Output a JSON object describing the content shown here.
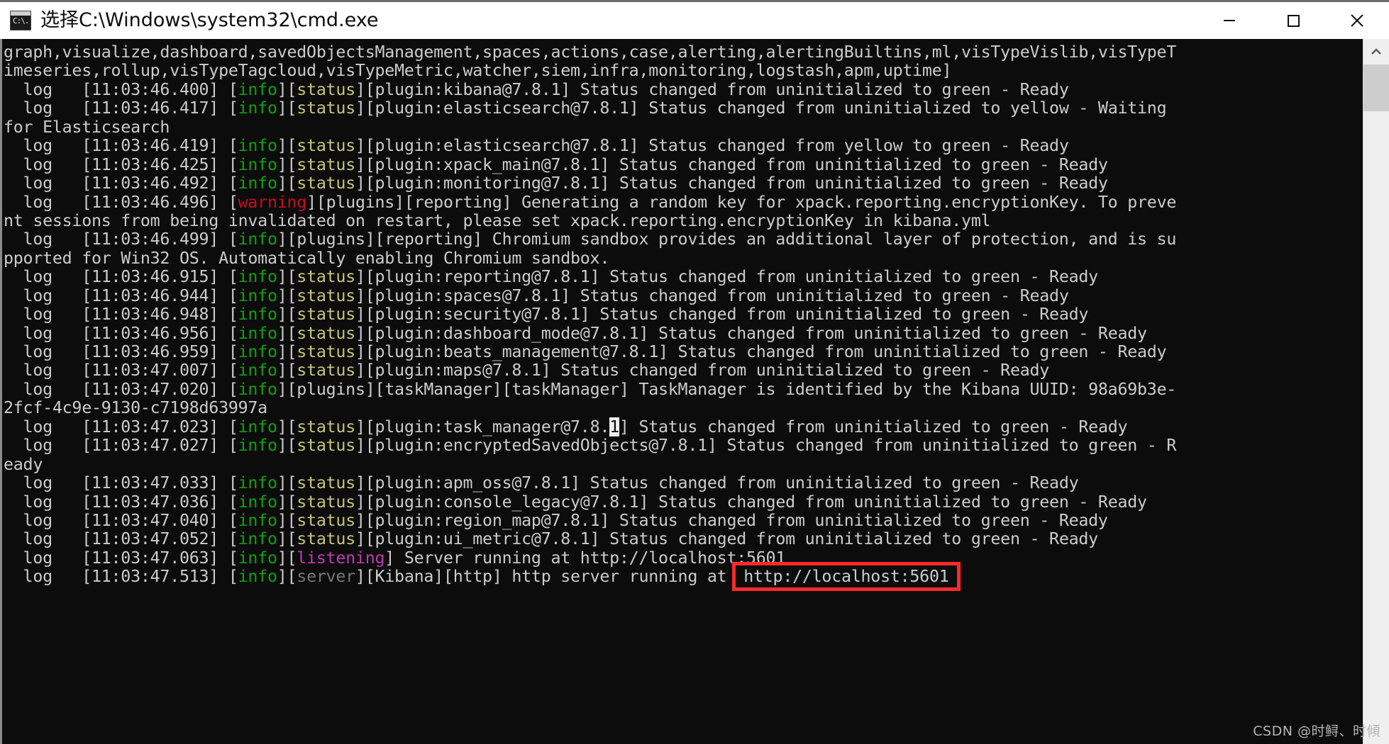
{
  "window": {
    "title": "选择C:\\Windows\\system32\\cmd.exe",
    "icon_name": "cmd-icon",
    "icon_prompt": "C:\\.",
    "minimize_label": "—",
    "maximize_label": "□",
    "close_label": "✕"
  },
  "watermark": "CSDN @时鲟、时傾",
  "colors": {
    "console_bg": "#0c0c0c",
    "console_fg": "#cccccc",
    "info": "#13a10e",
    "status": "#c5c57a",
    "warning": "#c50f1f",
    "listening": "#c239b3",
    "server": "#767676",
    "highlight_box": "#fa2a2a",
    "selection_bg": "#eeeeee"
  },
  "scrollbar": {
    "up_arrow": "▲",
    "thumb_position": "near-top"
  },
  "console": {
    "lines": [
      {
        "id": "l1",
        "parts": [
          {
            "t": "graph,visualize,dashboard,savedObjectsManagement,spaces,actions,case,alerting,alertingBuiltins,ml,visTypeVislib,visTypeT",
            "c": "c-default"
          }
        ]
      },
      {
        "id": "l2",
        "parts": [
          {
            "t": "imeseries,rollup,visTypeTagcloud,visTypeMetric,watcher,siem,infra,monitoring,logstash,apm,uptime]",
            "c": "c-default"
          }
        ]
      },
      {
        "id": "l3",
        "parts": [
          {
            "t": "  log   [11:03:46.400] [",
            "c": "c-default"
          },
          {
            "t": "info",
            "c": "c-green"
          },
          {
            "t": "][",
            "c": "c-default"
          },
          {
            "t": "status",
            "c": "c-yellow"
          },
          {
            "t": "][plugin:kibana@7.8.1] Status changed from uninitialized to green - Ready",
            "c": "c-default"
          }
        ]
      },
      {
        "id": "l4",
        "parts": [
          {
            "t": "  log   [11:03:46.417] [",
            "c": "c-default"
          },
          {
            "t": "info",
            "c": "c-green"
          },
          {
            "t": "][",
            "c": "c-default"
          },
          {
            "t": "status",
            "c": "c-yellow"
          },
          {
            "t": "][plugin:elasticsearch@7.8.1] Status changed from uninitialized to yellow - Waiting",
            "c": "c-default"
          }
        ]
      },
      {
        "id": "l5",
        "parts": [
          {
            "t": "for Elasticsearch",
            "c": "c-default"
          }
        ]
      },
      {
        "id": "l6",
        "parts": [
          {
            "t": "  log   [11:03:46.419] [",
            "c": "c-default"
          },
          {
            "t": "info",
            "c": "c-green"
          },
          {
            "t": "][",
            "c": "c-default"
          },
          {
            "t": "status",
            "c": "c-yellow"
          },
          {
            "t": "][plugin:elasticsearch@7.8.1] Status changed from yellow to green - Ready",
            "c": "c-default"
          }
        ]
      },
      {
        "id": "l7",
        "parts": [
          {
            "t": "  log   [11:03:46.425] [",
            "c": "c-default"
          },
          {
            "t": "info",
            "c": "c-green"
          },
          {
            "t": "][",
            "c": "c-default"
          },
          {
            "t": "status",
            "c": "c-yellow"
          },
          {
            "t": "][plugin:xpack_main@7.8.1] Status changed from uninitialized to green - Ready",
            "c": "c-default"
          }
        ]
      },
      {
        "id": "l8",
        "parts": [
          {
            "t": "  log   [11:03:46.492] [",
            "c": "c-default"
          },
          {
            "t": "info",
            "c": "c-green"
          },
          {
            "t": "][",
            "c": "c-default"
          },
          {
            "t": "status",
            "c": "c-yellow"
          },
          {
            "t": "][plugin:monitoring@7.8.1] Status changed from uninitialized to green - Ready",
            "c": "c-default"
          }
        ]
      },
      {
        "id": "l9",
        "parts": [
          {
            "t": "  log   [11:03:46.496] [",
            "c": "c-default"
          },
          {
            "t": "warning",
            "c": "c-red"
          },
          {
            "t": "][plugins][reporting] Generating a random key for xpack.reporting.encryptionKey. To preve",
            "c": "c-default"
          }
        ]
      },
      {
        "id": "l10",
        "parts": [
          {
            "t": "nt sessions from being invalidated on restart, please set xpack.reporting.encryptionKey in kibana.yml",
            "c": "c-default"
          }
        ]
      },
      {
        "id": "l11",
        "parts": [
          {
            "t": "  log   [11:03:46.499] [",
            "c": "c-default"
          },
          {
            "t": "info",
            "c": "c-green"
          },
          {
            "t": "][plugins][reporting] Chromium sandbox provides an additional layer of protection, and is su",
            "c": "c-default"
          }
        ]
      },
      {
        "id": "l12",
        "parts": [
          {
            "t": "pported for Win32 OS. Automatically enabling Chromium sandbox.",
            "c": "c-default"
          }
        ]
      },
      {
        "id": "l13",
        "parts": [
          {
            "t": "  log   [11:03:46.915] [",
            "c": "c-default"
          },
          {
            "t": "info",
            "c": "c-green"
          },
          {
            "t": "][",
            "c": "c-default"
          },
          {
            "t": "status",
            "c": "c-yellow"
          },
          {
            "t": "][plugin:reporting@7.8.1] Status changed from uninitialized to green - Ready",
            "c": "c-default"
          }
        ]
      },
      {
        "id": "l14",
        "parts": [
          {
            "t": "  log   [11:03:46.944] [",
            "c": "c-default"
          },
          {
            "t": "info",
            "c": "c-green"
          },
          {
            "t": "][",
            "c": "c-default"
          },
          {
            "t": "status",
            "c": "c-yellow"
          },
          {
            "t": "][plugin:spaces@7.8.1] Status changed from uninitialized to green - Ready",
            "c": "c-default"
          }
        ]
      },
      {
        "id": "l15",
        "parts": [
          {
            "t": "  log   [11:03:46.948] [",
            "c": "c-default"
          },
          {
            "t": "info",
            "c": "c-green"
          },
          {
            "t": "][",
            "c": "c-default"
          },
          {
            "t": "status",
            "c": "c-yellow"
          },
          {
            "t": "][plugin:security@7.8.1] Status changed from uninitialized to green - Ready",
            "c": "c-default"
          }
        ]
      },
      {
        "id": "l16",
        "parts": [
          {
            "t": "  log   [11:03:46.956] [",
            "c": "c-default"
          },
          {
            "t": "info",
            "c": "c-green"
          },
          {
            "t": "][",
            "c": "c-default"
          },
          {
            "t": "status",
            "c": "c-yellow"
          },
          {
            "t": "][plugin:dashboard_mode@7.8.1] Status changed from uninitialized to green - Ready",
            "c": "c-default"
          }
        ]
      },
      {
        "id": "l17",
        "parts": [
          {
            "t": "  log   [11:03:46.959] [",
            "c": "c-default"
          },
          {
            "t": "info",
            "c": "c-green"
          },
          {
            "t": "][",
            "c": "c-default"
          },
          {
            "t": "status",
            "c": "c-yellow"
          },
          {
            "t": "][plugin:beats_management@7.8.1] Status changed from uninitialized to green - Ready",
            "c": "c-default"
          }
        ]
      },
      {
        "id": "l18",
        "parts": [
          {
            "t": "  log   [11:03:47.007] [",
            "c": "c-default"
          },
          {
            "t": "info",
            "c": "c-green"
          },
          {
            "t": "][",
            "c": "c-default"
          },
          {
            "t": "status",
            "c": "c-yellow"
          },
          {
            "t": "][plugin:maps@7.8.1] Status changed from uninitialized to green - Ready",
            "c": "c-default"
          }
        ]
      },
      {
        "id": "l19",
        "parts": [
          {
            "t": "  log   [11:03:47.020] [",
            "c": "c-default"
          },
          {
            "t": "info",
            "c": "c-green"
          },
          {
            "t": "][plugins][taskManager][taskManager] TaskManager is identified by the Kibana UUID: 98a69b3e-",
            "c": "c-default"
          }
        ]
      },
      {
        "id": "l20",
        "parts": [
          {
            "t": "2fcf-4c9e-9130-c7198d63997a",
            "c": "c-default"
          }
        ]
      },
      {
        "id": "l21",
        "parts": [
          {
            "t": "  log   [11:03:47.023] [",
            "c": "c-default"
          },
          {
            "t": "info",
            "c": "c-green"
          },
          {
            "t": "][",
            "c": "c-default"
          },
          {
            "t": "status",
            "c": "c-yellow"
          },
          {
            "t": "][plugin:task_manager@7.8.",
            "c": "c-default"
          },
          {
            "t": "1",
            "c": "sel"
          },
          {
            "t": "] Status changed from uninitialized to green - Ready",
            "c": "c-default"
          }
        ]
      },
      {
        "id": "l22",
        "parts": [
          {
            "t": "  log   [11:03:47.027] [",
            "c": "c-default"
          },
          {
            "t": "info",
            "c": "c-green"
          },
          {
            "t": "][",
            "c": "c-default"
          },
          {
            "t": "status",
            "c": "c-yellow"
          },
          {
            "t": "][plugin:encryptedSavedObjects@7.8.1] Status changed from uninitialized to green - R",
            "c": "c-default"
          }
        ]
      },
      {
        "id": "l23",
        "parts": [
          {
            "t": "eady",
            "c": "c-default"
          }
        ]
      },
      {
        "id": "l24",
        "parts": [
          {
            "t": "  log   [11:03:47.033] [",
            "c": "c-default"
          },
          {
            "t": "info",
            "c": "c-green"
          },
          {
            "t": "][",
            "c": "c-default"
          },
          {
            "t": "status",
            "c": "c-yellow"
          },
          {
            "t": "][plugin:apm_oss@7.8.1] Status changed from uninitialized to green - Ready",
            "c": "c-default"
          }
        ]
      },
      {
        "id": "l25",
        "parts": [
          {
            "t": "  log   [11:03:47.036] [",
            "c": "c-default"
          },
          {
            "t": "info",
            "c": "c-green"
          },
          {
            "t": "][",
            "c": "c-default"
          },
          {
            "t": "status",
            "c": "c-yellow"
          },
          {
            "t": "][plugin:console_legacy@7.8.1] Status changed from uninitialized to green - Ready",
            "c": "c-default"
          }
        ]
      },
      {
        "id": "l26",
        "parts": [
          {
            "t": "  log   [11:03:47.040] [",
            "c": "c-default"
          },
          {
            "t": "info",
            "c": "c-green"
          },
          {
            "t": "][",
            "c": "c-default"
          },
          {
            "t": "status",
            "c": "c-yellow"
          },
          {
            "t": "][plugin:region_map@7.8.1] Status changed from uninitialized to green - Ready",
            "c": "c-default"
          }
        ]
      },
      {
        "id": "l27",
        "parts": [
          {
            "t": "  log   [11:03:47.052] [",
            "c": "c-default"
          },
          {
            "t": "info",
            "c": "c-green"
          },
          {
            "t": "][",
            "c": "c-default"
          },
          {
            "t": "status",
            "c": "c-yellow"
          },
          {
            "t": "][plugin:ui_metric@7.8.1] Status changed from uninitialized to green - Ready",
            "c": "c-default"
          }
        ]
      },
      {
        "id": "l28",
        "parts": [
          {
            "t": "  log   [11:03:47.063] [",
            "c": "c-default"
          },
          {
            "t": "info",
            "c": "c-green"
          },
          {
            "t": "][",
            "c": "c-default"
          },
          {
            "t": "listening",
            "c": "c-magenta"
          },
          {
            "t": "] Server running at http://localhost:5601",
            "c": "c-default"
          }
        ]
      },
      {
        "id": "l29",
        "parts": [
          {
            "t": "  log   [11:03:47.513] [",
            "c": "c-default"
          },
          {
            "t": "info",
            "c": "c-green"
          },
          {
            "t": "][",
            "c": "c-default"
          },
          {
            "t": "server",
            "c": "c-gray"
          },
          {
            "t": "][Kibana][http] http server running at ",
            "c": "c-default"
          },
          {
            "t": "http://localhost:5601",
            "c": "urlbox"
          }
        ]
      }
    ]
  }
}
